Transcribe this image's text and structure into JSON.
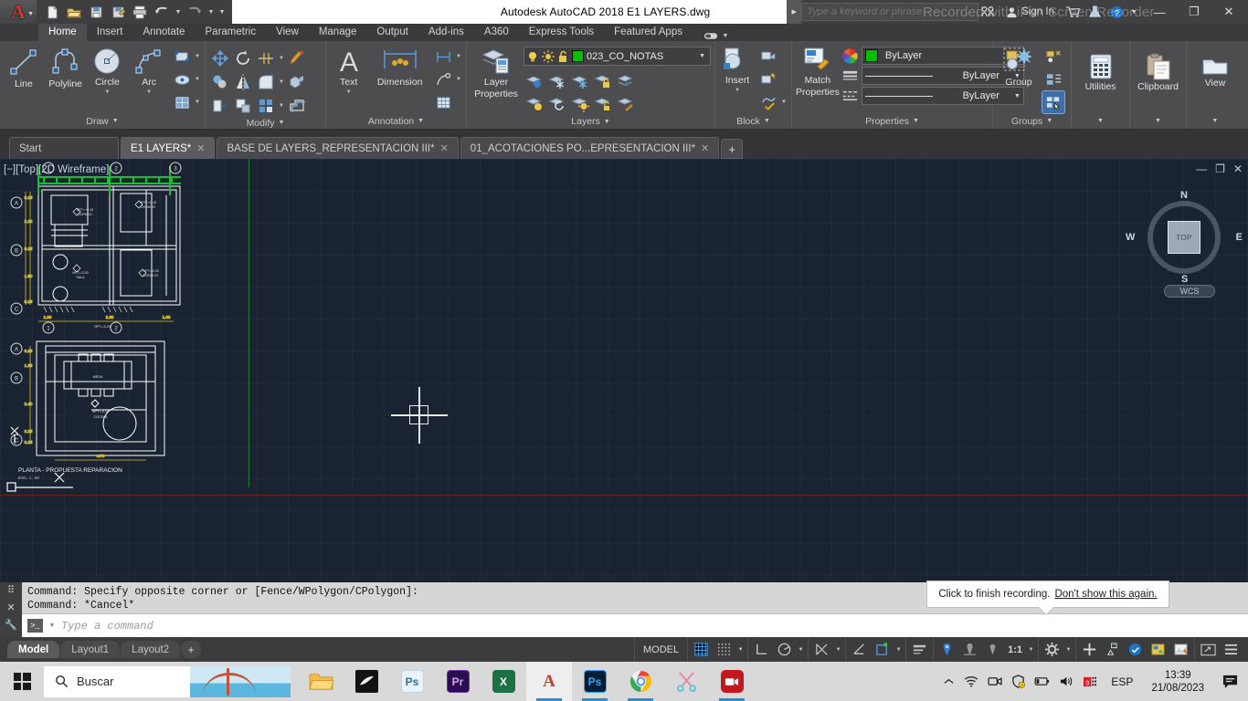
{
  "titlebar": {
    "app_glyph": "A",
    "quick_access": [
      {
        "name": "new-file-icon",
        "label": "New"
      },
      {
        "name": "open-file-icon",
        "label": "Open"
      },
      {
        "name": "save-icon",
        "label": "Save"
      },
      {
        "name": "save-as-icon",
        "label": "Save As"
      },
      {
        "name": "plot-icon",
        "label": "Plot"
      },
      {
        "name": "undo-icon",
        "label": "Undo"
      },
      {
        "name": "redo-icon",
        "label": "Redo"
      }
    ],
    "title": "Autodesk AutoCAD 2018    E1 LAYERS.dwg",
    "search_placeholder": "Type a keyword or phrase",
    "signin_label": "Sign In",
    "minimize": "—",
    "maximize": "❐",
    "close": "✕",
    "watermark": "Recorded with iFun Screen Recorder"
  },
  "ribbon_tabs": [
    {
      "label": "Home",
      "active": true
    },
    {
      "label": "Insert",
      "active": false
    },
    {
      "label": "Annotate",
      "active": false
    },
    {
      "label": "Parametric",
      "active": false
    },
    {
      "label": "View",
      "active": false
    },
    {
      "label": "Manage",
      "active": false
    },
    {
      "label": "Output",
      "active": false
    },
    {
      "label": "Add-ins",
      "active": false
    },
    {
      "label": "A360",
      "active": false
    },
    {
      "label": "Express Tools",
      "active": false
    },
    {
      "label": "Featured Apps",
      "active": false
    }
  ],
  "ribbon": {
    "draw": {
      "title": "Draw",
      "buttons": [
        {
          "label": "Line",
          "icon": "line-icon"
        },
        {
          "label": "Polyline",
          "icon": "polyline-icon"
        },
        {
          "label": "Circle",
          "icon": "circle-icon"
        },
        {
          "label": "Arc",
          "icon": "arc-icon"
        }
      ],
      "small": [
        "rectangle-icon",
        "ellipse-icon",
        "hatch-icon"
      ]
    },
    "modify": {
      "title": "Modify",
      "small": [
        "move-icon",
        "rotate-icon",
        "trim-icon",
        "erase-icon",
        "copy-icon",
        "mirror-icon",
        "fillet-icon",
        "array-icon",
        "stretch-icon",
        "scale-icon",
        "array-rect-icon",
        "explode-icon"
      ]
    },
    "annotation": {
      "title": "Annotation",
      "text_label": "Text",
      "dimension_label": "Dimension",
      "small": [
        "linear-dim-icon",
        "leader-icon",
        "table-icon"
      ]
    },
    "layers": {
      "title": "Layers",
      "layer_properties_label": "Layer\nProperties",
      "layer_properties_line1": "Layer",
      "layer_properties_line2": "Properties",
      "current_layer": "023_CO_NOTAS",
      "layer_color": "#00c000",
      "state_icons": [
        "lightbulb-on-icon",
        "sun-icon",
        "unlock-icon"
      ],
      "small": [
        "layer-isolate-icon",
        "layer-freeze-icon",
        "layer-off-icon",
        "layer-lock-icon",
        "layer-merge-icon",
        "layer-unisolate-icon",
        "layer-previous-icon",
        "layer-on-icon",
        "layer-unlock-icon",
        "layer-match-icon"
      ]
    },
    "block": {
      "title": "Block",
      "insert_label": "Insert",
      "small": [
        "create-block-icon",
        "edit-block-icon",
        "block-attribute-icon"
      ]
    },
    "properties": {
      "title": "Properties",
      "match_properties_line1": "Match",
      "match_properties_line2": "Properties",
      "color_icon": "color-wheel-icon",
      "color_value": "ByLayer",
      "color_swatch": "#00c000",
      "linetype_value": "ByLayer",
      "lineweight_value": "ByLayer"
    },
    "groups": {
      "title": "Groups",
      "group_label": "Group",
      "small": [
        "ungroup-icon",
        "group-edit-icon",
        "group-selection-icon"
      ],
      "selected_small": "group-selection-icon"
    },
    "utilities": {
      "title": "",
      "label": "Utilities",
      "icon": "calculator-icon"
    },
    "clipboard": {
      "title": "",
      "label": "Clipboard",
      "icon": "paste-icon"
    },
    "view": {
      "title": "",
      "label": "View",
      "icon": "window-icon"
    }
  },
  "file_tabs": [
    {
      "label": "Start",
      "active": false,
      "closable": false,
      "kind": "start"
    },
    {
      "label": "E1 LAYERS*",
      "active": true,
      "closable": true,
      "kind": "doc"
    },
    {
      "label": "BASE DE LAYERS_REPRESENTACION III*",
      "active": false,
      "closable": true,
      "kind": "doc"
    },
    {
      "label": "01_ACOTACIONES PO...EPRESENTACION III*",
      "active": false,
      "closable": true,
      "kind": "doc"
    }
  ],
  "file_tab_add": "+",
  "canvas": {
    "viewport_label": "[−][Top][2D Wireframe]",
    "background": "#1a2331",
    "window_controls": [
      "—",
      "❐",
      "✕"
    ],
    "viewcube": {
      "top": "TOP",
      "north": "N",
      "south": "S",
      "east": "E",
      "west": "W"
    },
    "wcs_label": "WCS",
    "drawing": {
      "title": "PLANTA - PROPUESTA REPARACION",
      "scale_note": "ESC. 1 : 50",
      "grid_labels_top": [
        "1",
        "2",
        "3"
      ],
      "grid_labels_left": [
        "A",
        "B",
        "C"
      ],
      "grid_labels_lower_left": [
        "A",
        "B",
        "C"
      ],
      "grid_labels_lower_top": [
        "1",
        "2"
      ],
      "room_labels": [
        "NPT = +0.15\nDORM 01",
        "NPT = -0.20\nDORM 02",
        "NPT +0.15\nSALA",
        "NPT -0.20",
        "MESA",
        "COCINA"
      ],
      "dimension_values": [
        "0.15",
        "2.10",
        "0.15",
        "1.50",
        "0.15",
        "1.00",
        "2.30",
        "1.00",
        "4.70"
      ]
    }
  },
  "command_line": {
    "history": [
      "Command: Specify opposite corner or [Fence/WPolygon/CPolygon]:",
      "Command: *Cancel*"
    ],
    "placeholder": "Type a command",
    "prompt_icon": ">_"
  },
  "tooltip": {
    "text": "Click to finish recording.",
    "link": "Don't show this again."
  },
  "statusbar": {
    "layout_tabs": [
      {
        "label": "Model",
        "active": true
      },
      {
        "label": "Layout1",
        "active": false
      },
      {
        "label": "Layout2",
        "active": false
      }
    ],
    "layout_add": "+",
    "model_button": "MODEL",
    "scale": "1:1",
    "toggles": [
      {
        "name": "grid-display-icon",
        "on": true
      },
      {
        "name": "snap-mode-icon",
        "on": false
      },
      {
        "name": "ortho-mode-icon",
        "on": false
      },
      {
        "name": "polar-tracking-icon",
        "on": false
      },
      {
        "name": "object-snap-tracking-icon",
        "on": false
      },
      {
        "name": "object-snap-icon",
        "on": false
      },
      {
        "name": "dynamic-ucs-icon",
        "on": true
      },
      {
        "name": "lineweight-icon",
        "on": false
      },
      {
        "name": "transparency-icon",
        "on": true
      },
      {
        "name": "selection-cycling-icon",
        "on": false
      },
      {
        "name": "annotation-monitor-icon",
        "on": false
      },
      {
        "name": "annotation-scale-icon",
        "on": false
      },
      {
        "name": "workspace-icon",
        "on": false
      },
      {
        "name": "hardware-accel-icon",
        "on": false
      },
      {
        "name": "isolate-objects-icon",
        "on": false
      },
      {
        "name": "clean-screen-icon",
        "on": false
      },
      {
        "name": "customization-icon",
        "on": false
      }
    ]
  },
  "taskbar": {
    "start_name": "start-button",
    "search_placeholder": "Buscar",
    "apps": [
      {
        "name": "file-explorer-icon",
        "label": "",
        "color": "#f5b942",
        "active": false,
        "running": false
      },
      {
        "name": "media-app-icon",
        "label": "",
        "color": "#101010",
        "active": false,
        "running": false
      },
      {
        "name": "photoshop-icon",
        "label": "Ps",
        "color": "#e8f4fb",
        "active": false,
        "running": false
      },
      {
        "name": "premiere-icon",
        "label": "Pr",
        "color": "#2a0d52",
        "active": false,
        "running": false
      },
      {
        "name": "excel-icon",
        "label": "X",
        "color": "#1d7044",
        "active": false,
        "running": false
      },
      {
        "name": "autocad-icon",
        "label": "A",
        "color": "#ffffff",
        "active": true,
        "running": true
      },
      {
        "name": "photoshop-2-icon",
        "label": "Ps",
        "color": "#001e36",
        "active": false,
        "running": true
      },
      {
        "name": "chrome-icon",
        "label": "",
        "color": "#ffffff",
        "active": false,
        "running": true
      },
      {
        "name": "snipping-tool-icon",
        "label": "",
        "color": "#ffffff",
        "active": false,
        "running": false
      },
      {
        "name": "screen-recorder-icon",
        "label": "",
        "color": "#c4181f",
        "active": false,
        "running": true
      }
    ],
    "tray": [
      "chevron-up-icon",
      "wifi-icon",
      "camera-icon",
      "security-icon",
      "battery-icon",
      "volume-icon",
      "app-tray-icon"
    ],
    "language": "ESP",
    "time": "13:39",
    "date": "21/08/2023",
    "action_center": "notifications-icon"
  }
}
